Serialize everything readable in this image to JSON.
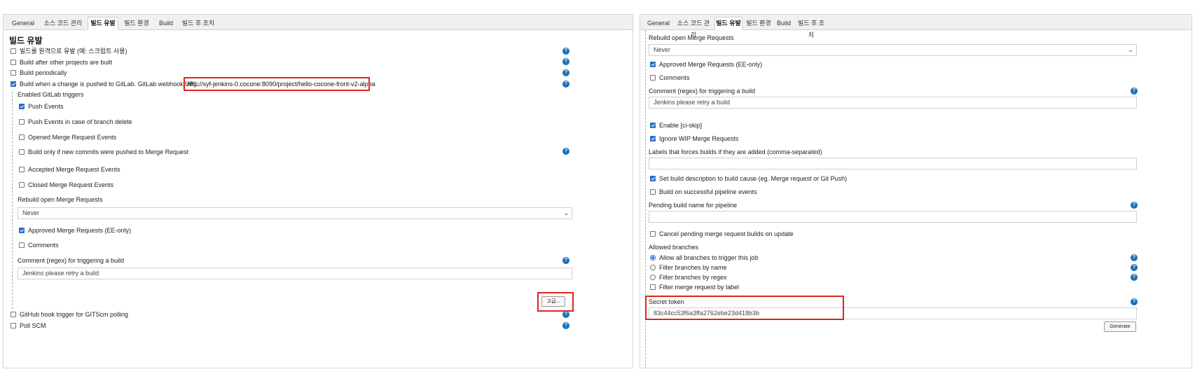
{
  "left": {
    "tabs": [
      "General",
      "소스 코드 관리",
      "빌드 유발",
      "빌드 환경",
      "Build",
      "빌드 후 조치"
    ],
    "active_tab": "빌드 유발",
    "section_title": "빌드 유발",
    "remote_trigger_label": "빌드를 원격으로 유발 (예: 스크립트 사용)",
    "after_other_projects_label": "Build after other projects are built",
    "periodically_label": "Build periodically",
    "gitlab_push_label": "Build when a change is pushed to GitLab. GitLab webhook URL:",
    "gitlab_webhook_url": "http://syf-jenkins-0.cocone:8090/project/hello-cocone-front-v2-alpha",
    "enabled_triggers_heading": "Enabled GitLab triggers",
    "push_events_label": "Push Events",
    "push_events_branch_delete_label": "Push Events in case of branch delete",
    "opened_mr_events_label": "Opened Merge Request Events",
    "new_commits_mr_label": "Build only if new commits were pushed to Merge Request",
    "accepted_mr_events_label": "Accepted Merge Request Events",
    "closed_mr_events_label": "Closed Merge Request Events",
    "rebuild_open_mr_label": "Rebuild open Merge Requests",
    "rebuild_open_mr_value": "Never",
    "approved_mr_label": "Approved Merge Requests (EE-only)",
    "comments_label": "Comments",
    "comment_regex_label": "Comment (regex) for triggering a build",
    "comment_regex_value": "Jenkins please retry a build",
    "advanced_button_label": "고급...",
    "github_hook_label": "GitHub hook trigger for GITScm polling",
    "poll_scm_label": "Poll SCM"
  },
  "right": {
    "tabs": [
      "General",
      "소스 코드 관리",
      "빌드 유발",
      "빌드 환경",
      "Build",
      "빌드 후 조치"
    ],
    "active_tab": "빌드 유발",
    "rebuild_open_mr_label": "Rebuild open Merge Requests",
    "rebuild_open_mr_value": "Never",
    "approved_mr_label": "Approved Merge Requests (EE-only)",
    "comments_label": "Comments",
    "comment_regex_label": "Comment (regex) for triggering a build",
    "comment_regex_value": "Jenkins please retry a build",
    "enable_ci_skip_label": "Enable [ci-skip]",
    "ignore_wip_label": "Ignore WIP Merge Requests",
    "labels_force_label": "Labels that forces builds if they are added (comma-separated)",
    "labels_force_value": "",
    "set_build_description_label": "Set build description to build cause (eg. Merge request or Git Push)",
    "build_on_pipeline_label": "Build on successful pipeline events",
    "pending_build_name_label": "Pending build name for pipeline",
    "pending_build_name_value": "",
    "cancel_pending_label": "Cancel pending merge request builds on update",
    "allowed_branches_heading": "Allowed branches",
    "allow_all_label": "Allow all branches to trigger this job",
    "filter_by_name_label": "Filter branches by name",
    "filter_by_regex_label": "Filter branches by regex",
    "filter_mr_label_label": "Filter merge request by label",
    "secret_token_label": "Secret token",
    "secret_token_value": "83c44cc53f6a3ffa2762ebe23d418b3b",
    "generate_button_label": "Generate"
  },
  "colors": {
    "highlight": "#e0241b",
    "help": "#1f6fb5",
    "checkbox": "#2b6fc2"
  },
  "icons": {
    "help": "question-circle-icon",
    "select": "chevron-down-icon"
  }
}
